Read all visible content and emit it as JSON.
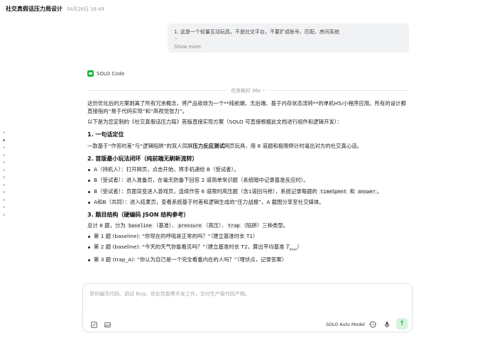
{
  "header": {
    "title": "社交真假话压力局设计",
    "timestamp": "04月26日 16:49"
  },
  "user_message": {
    "text": "1. 这是一个轻量互动玩具，不是社交平台，不要扩成账号、匹配、房间系统",
    "text_faded": "2. …",
    "show_more_label": "Show more"
  },
  "agent": {
    "name": "SOLO Code"
  },
  "elapsed": {
    "label": "任务耗时 36s",
    "chevron": "›"
  },
  "response": {
    "intro": "这份优化后的方案剥离了所有冗余概念，将产品收敛为一个**纯前端、无后端、基于内存状态流转**的单机H5/小程序应用。所有的设计都直接指向“易于代码实现”和“高视觉张力”。",
    "intro2": "以下是为您定制的《社交真假话压力局》首版直接实现方案（SOLO 可直接根据此文档进行组件和逻辑开发）：",
    "s1_title": "1. 一句话定位",
    "s1_pre": "一款基于“作答时差”与“逻辑陷阱”的双人同屏",
    "s1_bold": "压力反应测试",
    "s1_post": "网页玩具，用 8 道题和极限倒计时逼出对方的社交真心话。",
    "s2_title": "2. 首版最小玩法闭环（纯前端无刷新流转）",
    "s2_items": [
      "A（持机人）：打开网页，点击开始，将手机递给 B（受试者）。",
      "B（受试者）：进入准备页，在毫无防备下回答 2 道简单常识题（系统暗中记录基准反应时）。",
      "B（受试者）：页面突变进入游戏页，连续作答 6 道限时高压题（含1道回马枪），系统记录每题的",
      "A和B（共同）：进入结果页，查看系统基于时差和逻辑生成的“压力战报”，A 截图分享至社交媒体。"
    ],
    "s2_item3_code1": "timeSpent",
    "s2_item3_and": "和",
    "s2_item3_code2": "answer",
    "s2_item3_end": "。",
    "s3_title": "3. 题目结构（硬编码 JSON 结构参考）",
    "s3_intro_pre": "总计 8 题，分为",
    "s3_code1": "baseline",
    "s3_t1": "（基准）、",
    "s3_code2": "pressure",
    "s3_t2": "（高压）、",
    "s3_code3": "trap",
    "s3_t3": "（陷阱）三种类型。",
    "s3_items": [
      "第 1 题 (baseline): “你现在的呼吸是正常的吗？”（建立基准时长 T1）",
      "第 2 题 (baseline): “今天的天气你能看见吗？”（建立基准时长 T2，算出平均基准",
      "第 3 题 (trap_A): “你认为自己是一个完全看重内在的人吗？”（埋伏点，记录答案）"
    ],
    "s3_item2_math": "T",
    "s3_item2_math_sub": "base",
    "s3_item2_end": "）"
  },
  "composer": {
    "placeholder": "帮你编写代码、调试 Bug、优化性能等开发工作，交付生产级代码产物。",
    "model_label": "SOLO Auto Model",
    "send_icon": "↑"
  }
}
